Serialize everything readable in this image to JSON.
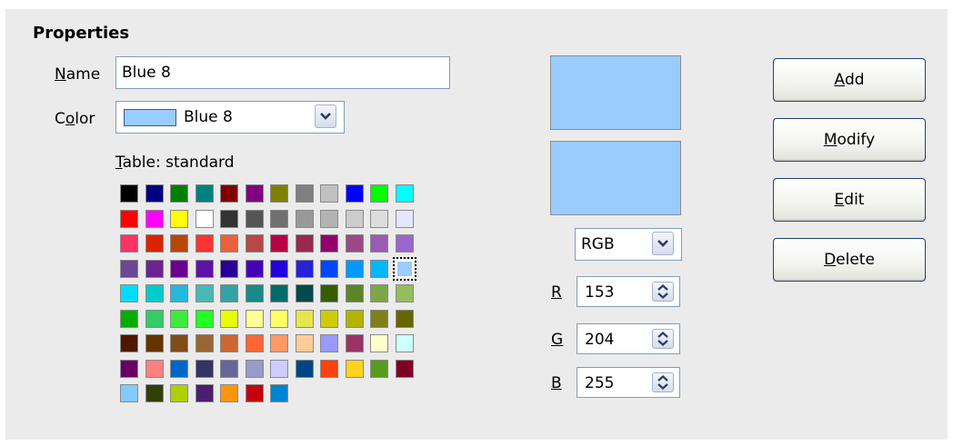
{
  "section_title": "Properties",
  "name_label": {
    "accel": "N",
    "rest": "ame"
  },
  "name_value": "Blue 8",
  "color_label": {
    "pre": "C",
    "accel": "o",
    "rest": "lor"
  },
  "color_value": "Blue 8",
  "color_swatch": "#99ccff",
  "table_label": {
    "accel": "T",
    "rest": "able: standard"
  },
  "palette_rows": [
    [
      "#000000",
      "#000080",
      "#008000",
      "#008080",
      "#800000",
      "#800080",
      "#808000",
      "#808080",
      "#c0c0c0",
      "#0000ff",
      "#00ff00",
      "#00ffff"
    ],
    [
      "#ff0000",
      "#ff00ff",
      "#ffff00",
      "#ffffff",
      "#333333",
      "#555555",
      "#707070",
      "#999999",
      "#b3b3b3",
      "#cccccc",
      "#dddddd",
      "#e6e6ff"
    ],
    [
      "#ff3366",
      "#dc2300",
      "#b84700",
      "#ff3333",
      "#eb613d",
      "#b84747",
      "#b80047",
      "#99284c",
      "#94006b",
      "#994a86",
      "#9a5bb3",
      "#9966cc"
    ],
    [
      "#6b4794",
      "#6b2394",
      "#6b0094",
      "#5e11a6",
      "#280099",
      "#4700b8",
      "#2300dc",
      "#2323dc",
      "#0047ff",
      "#0099ff",
      "#00b8ff",
      "#99ccff"
    ],
    [
      "#00dcff",
      "#00cccc",
      "#23b8dc",
      "#47b8b8",
      "#33a3a3",
      "#198a8a",
      "#006b6b",
      "#004a4a",
      "#355e00",
      "#5c8526",
      "#7da647",
      "#94bd5e"
    ],
    [
      "#00ae00",
      "#33cc66",
      "#3deb3d",
      "#23ff23",
      "#e6ff00",
      "#ffff99",
      "#ffff66",
      "#e6e64c",
      "#cccc00",
      "#b3b300",
      "#808019",
      "#666600"
    ],
    [
      "#4c1900",
      "#663300",
      "#804c19",
      "#996633",
      "#cc6633",
      "#ff6633",
      "#ff9966",
      "#ffcc99",
      "#9999ff",
      "#993366",
      "#ffffcc",
      "#ccffff"
    ],
    [
      "#660066",
      "#ff8080",
      "#0066cc",
      "#333366",
      "#666699",
      "#9999cc",
      "#ccccff",
      "#004586",
      "#ff420e",
      "#ffd320",
      "#579d1c",
      "#7e0021"
    ],
    [
      "#83caff",
      "#314004",
      "#aecf00",
      "#4b1f6f",
      "#ff950e",
      "#c5000b",
      "#0084d1"
    ]
  ],
  "selected_cell": {
    "row": 3,
    "col": 11
  },
  "preview_old": "#99ccff",
  "preview_new": "#99ccff",
  "color_model": "RGB",
  "channels": [
    {
      "label": "R",
      "value": "153"
    },
    {
      "label": "G",
      "value": "204"
    },
    {
      "label": "B",
      "value": "255"
    }
  ],
  "buttons": [
    {
      "accel": "A",
      "rest": "dd"
    },
    {
      "accel": "M",
      "rest": "odify"
    },
    {
      "accel": "E",
      "rest": "dit"
    },
    {
      "accel": "D",
      "rest": "elete"
    }
  ]
}
